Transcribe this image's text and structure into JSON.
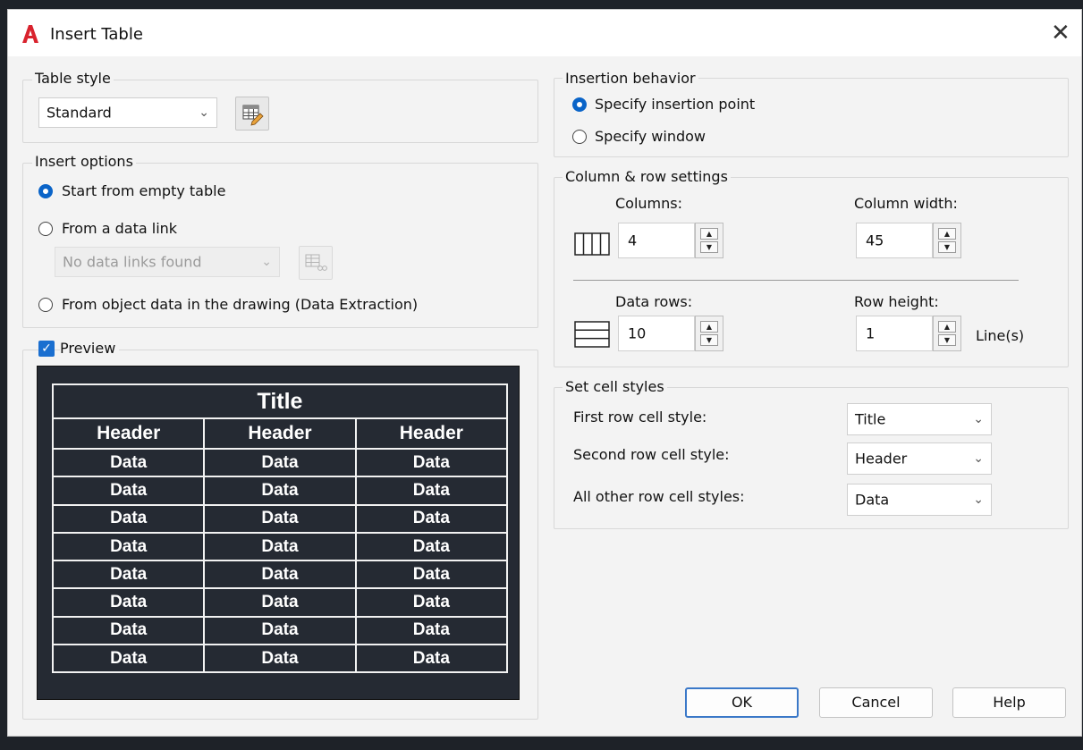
{
  "window": {
    "title": "Insert Table",
    "close_glyph": "✕"
  },
  "table_style": {
    "legend": "Table style",
    "selected": "Standard",
    "edit_icon": "table-style-edit-icon"
  },
  "insert_options": {
    "legend": "Insert options",
    "options": [
      {
        "label": "Start from empty table",
        "selected": true
      },
      {
        "label": "From a data link",
        "selected": false
      },
      {
        "label": "From object data in the drawing (Data Extraction)",
        "selected": false
      }
    ],
    "data_link_select": "No data links found"
  },
  "preview": {
    "label": "Preview",
    "checked": true,
    "title": "Title",
    "headers": [
      "Header",
      "Header",
      "Header"
    ],
    "rows": [
      [
        "Data",
        "Data",
        "Data"
      ],
      [
        "Data",
        "Data",
        "Data"
      ],
      [
        "Data",
        "Data",
        "Data"
      ],
      [
        "Data",
        "Data",
        "Data"
      ],
      [
        "Data",
        "Data",
        "Data"
      ],
      [
        "Data",
        "Data",
        "Data"
      ],
      [
        "Data",
        "Data",
        "Data"
      ],
      [
        "Data",
        "Data",
        "Data"
      ]
    ]
  },
  "insertion_behavior": {
    "legend": "Insertion behavior",
    "options": [
      {
        "label": "Specify insertion point",
        "selected": true
      },
      {
        "label": "Specify window",
        "selected": false
      }
    ]
  },
  "column_row": {
    "legend": "Column & row settings",
    "columns_label": "Columns:",
    "columns_value": "4",
    "column_width_label": "Column width:",
    "column_width_value": "45",
    "data_rows_label": "Data rows:",
    "data_rows_value": "10",
    "row_height_label": "Row height:",
    "row_height_value": "1",
    "row_height_unit": "Line(s)"
  },
  "cell_styles": {
    "legend": "Set cell styles",
    "first_row_label": "First row cell style:",
    "first_row_value": "Title",
    "second_row_label": "Second row cell style:",
    "second_row_value": "Header",
    "other_rows_label": "All other row cell styles:",
    "other_rows_value": "Data"
  },
  "buttons": {
    "ok": "OK",
    "cancel": "Cancel",
    "help": "Help"
  },
  "colors": {
    "accent": "#0a64c8",
    "preview_bg": "#252a33",
    "logo_red": "#d9232e"
  }
}
